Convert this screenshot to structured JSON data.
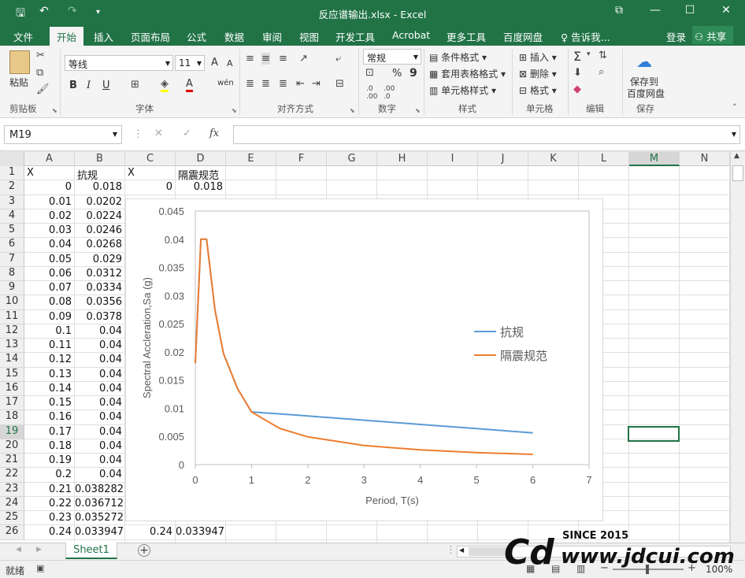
{
  "titlebar": {
    "title": "反应谱输出.xlsx - Excel",
    "save": "🖫",
    "undo": "↶",
    "redo": "↷",
    "qa_more": "▾",
    "ribbon_display": "⧉",
    "min": "—",
    "max": "☐",
    "close": "✕"
  },
  "tabs": [
    "文件",
    "开始",
    "插入",
    "页面布局",
    "公式",
    "数据",
    "审阅",
    "视图",
    "开发工具",
    "Acrobat",
    "更多工具",
    "百度网盘",
    "告诉我..."
  ],
  "account": {
    "login": "登录",
    "share": "共享"
  },
  "ribbon": {
    "clipboard": {
      "paste": "粘贴",
      "group": "剪贴板"
    },
    "font": {
      "name": "等线",
      "size": "11",
      "grow": "A",
      "shrink": "A",
      "bold": "B",
      "italic": "I",
      "underline": "U",
      "wen": "wén",
      "group": "字体"
    },
    "alignment": {
      "group": "对齐方式"
    },
    "number": {
      "format": "常规",
      "percent": "%",
      "comma": "9",
      "group": "数字"
    },
    "styles": {
      "cond": "条件格式",
      "table": "套用表格格式",
      "cell": "单元格样式",
      "group": "样式"
    },
    "cells": {
      "insert": "插入",
      "delete": "删除",
      "format": "格式",
      "group": "单元格"
    },
    "editing": {
      "sum": "Σ",
      "group": "编辑"
    },
    "save": {
      "label1": "保存到",
      "label2": "百度网盘",
      "group": "保存"
    }
  },
  "formula_bar": {
    "name_box": "M19",
    "cancel": "✕",
    "enter": "✓",
    "fx": "fx",
    "value": ""
  },
  "columns": [
    "A",
    "B",
    "C",
    "D",
    "E",
    "F",
    "G",
    "H",
    "I",
    "J",
    "K",
    "L",
    "M",
    "N"
  ],
  "selected_column": "M",
  "selected_row": 19,
  "rows": [
    {
      "n": 1,
      "a": "X",
      "b": "抗规",
      "c": "X",
      "d": "隔震规范"
    },
    {
      "n": 2,
      "a": "0",
      "b": "0.018",
      "c": "0",
      "d": "0.018"
    },
    {
      "n": 3,
      "a": "0.01",
      "b": "0.0202"
    },
    {
      "n": 4,
      "a": "0.02",
      "b": "0.0224"
    },
    {
      "n": 5,
      "a": "0.03",
      "b": "0.0246"
    },
    {
      "n": 6,
      "a": "0.04",
      "b": "0.0268"
    },
    {
      "n": 7,
      "a": "0.05",
      "b": "0.029"
    },
    {
      "n": 8,
      "a": "0.06",
      "b": "0.0312"
    },
    {
      "n": 9,
      "a": "0.07",
      "b": "0.0334"
    },
    {
      "n": 10,
      "a": "0.08",
      "b": "0.0356"
    },
    {
      "n": 11,
      "a": "0.09",
      "b": "0.0378"
    },
    {
      "n": 12,
      "a": "0.1",
      "b": "0.04"
    },
    {
      "n": 13,
      "a": "0.11",
      "b": "0.04"
    },
    {
      "n": 14,
      "a": "0.12",
      "b": "0.04"
    },
    {
      "n": 15,
      "a": "0.13",
      "b": "0.04"
    },
    {
      "n": 16,
      "a": "0.14",
      "b": "0.04"
    },
    {
      "n": 17,
      "a": "0.15",
      "b": "0.04"
    },
    {
      "n": 18,
      "a": "0.16",
      "b": "0.04"
    },
    {
      "n": 19,
      "a": "0.17",
      "b": "0.04"
    },
    {
      "n": 20,
      "a": "0.18",
      "b": "0.04"
    },
    {
      "n": 21,
      "a": "0.19",
      "b": "0.04"
    },
    {
      "n": 22,
      "a": "0.2",
      "b": "0.04"
    },
    {
      "n": 23,
      "a": "0.21",
      "b": "0.038282"
    },
    {
      "n": 24,
      "a": "0.22",
      "b": "0.036712"
    },
    {
      "n": 25,
      "a": "0.23",
      "b": "0.035272",
      "c": "0.23",
      "d": "0.035272"
    },
    {
      "n": 26,
      "a": "0.24",
      "b": "0.033947",
      "c": "0.24",
      "d": "0.033947"
    }
  ],
  "chart_data": {
    "type": "line",
    "xlabel": "Period, T(s)",
    "ylabel": "Spectral Accleration,Sa (g)",
    "xlim": [
      0,
      7
    ],
    "ylim": [
      0,
      0.045
    ],
    "xticks": [
      "0",
      "1",
      "2",
      "3",
      "4",
      "5",
      "6",
      "7"
    ],
    "yticks": [
      "0",
      "0.005",
      "0.01",
      "0.015",
      "0.02",
      "0.025",
      "0.03",
      "0.035",
      "0.04",
      "0.045"
    ],
    "legend_position": "right",
    "series": [
      {
        "name": "抗规",
        "color": "#5b9bd5",
        "x": [
          0,
          0.1,
          0.2,
          0.35,
          0.5,
          0.75,
          1,
          1.5,
          2,
          3,
          4,
          5,
          6
        ],
        "y": [
          0.018,
          0.04,
          0.04,
          0.02743,
          0.01975,
          0.01349,
          0.00935,
          0.009,
          0.00863,
          0.00788,
          0.00713,
          0.00638,
          0.00563
        ]
      },
      {
        "name": "隔震规范",
        "color": "#ed7d31",
        "x": [
          0,
          0.1,
          0.2,
          0.35,
          0.5,
          0.75,
          1,
          1.5,
          2,
          3,
          4,
          5,
          6
        ],
        "y": [
          0.018,
          0.04,
          0.04,
          0.02743,
          0.01975,
          0.01349,
          0.00935,
          0.00643,
          0.00492,
          0.0034,
          0.00262,
          0.00214,
          0.00182
        ]
      }
    ]
  },
  "sheet_tabs": [
    "Sheet1"
  ],
  "add_sheet": "+",
  "status": {
    "ready": "就绪",
    "zoom": "100%"
  },
  "watermark": {
    "since": "SINCE 2015",
    "url": "www.jdcui.com"
  }
}
